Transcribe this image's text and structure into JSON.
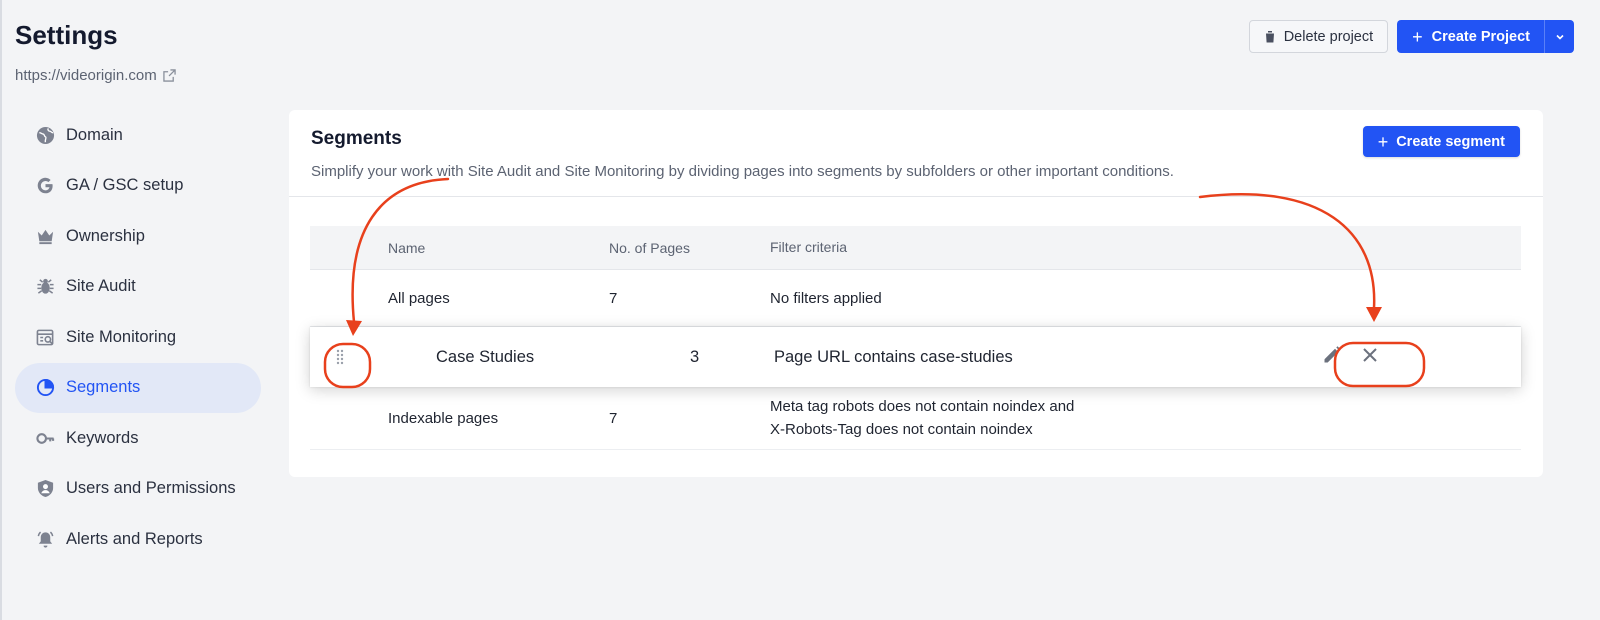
{
  "header": {
    "title": "Settings",
    "site_url": "https://videorigin.com",
    "delete_label": "Delete project",
    "create_label": "Create Project"
  },
  "sidebar": {
    "items": [
      {
        "label": "Domain",
        "icon": "globe-icon"
      },
      {
        "label": "GA / GSC setup",
        "icon": "google-icon"
      },
      {
        "label": "Ownership",
        "icon": "crown-icon"
      },
      {
        "label": "Site Audit",
        "icon": "bug-icon"
      },
      {
        "label": "Site Monitoring",
        "icon": "monitor-search-icon"
      },
      {
        "label": "Segments",
        "icon": "pie-chart-icon",
        "active": true
      },
      {
        "label": "Keywords",
        "icon": "key-icon"
      },
      {
        "label": "Users and Permissions",
        "icon": "shield-user-icon"
      },
      {
        "label": "Alerts and Reports",
        "icon": "bell-icon"
      }
    ]
  },
  "segments": {
    "title": "Segments",
    "description": "Simplify your work with Site Audit and Site Monitoring by dividing pages into segments by subfolders or other important conditions.",
    "create_label": "Create segment",
    "columns": [
      "Name",
      "No. of Pages",
      "Filter criteria"
    ],
    "rows": [
      {
        "name": "All pages",
        "pages": "7",
        "filter": "No filters applied"
      },
      {
        "name": "Case Studies",
        "pages": "3",
        "filter": "Page URL contains case-studies"
      },
      {
        "name": "Indexable pages",
        "pages": "7",
        "filter_line1": "Meta tag robots does not contain noindex and",
        "filter_line2": "X-Robots-Tag does not contain noindex"
      }
    ]
  },
  "colors": {
    "accent": "#2254f4",
    "annotation": "#e8401c",
    "active_bg": "#e2e8f7"
  }
}
